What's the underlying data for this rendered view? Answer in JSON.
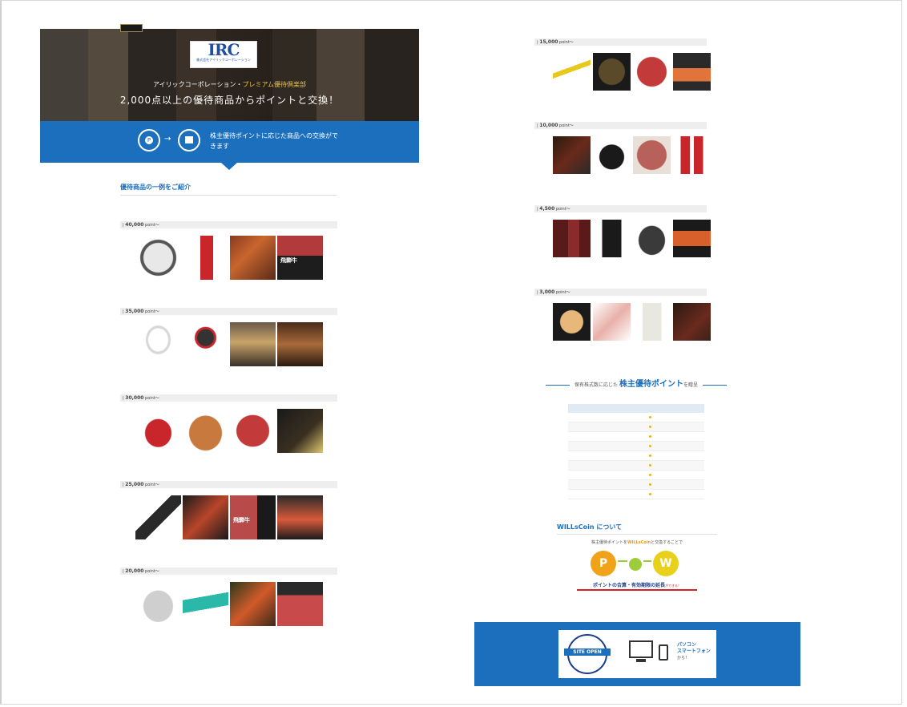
{
  "header": {
    "top_note": "",
    "logo_text": "IRC",
    "logo_sub": "株式会社アイリックコーポレーション",
    "hero_line1_prefix": "アイリックコーポレーション・",
    "hero_line1_gold": "プレミアム優待倶楽部",
    "hero_line2": "2,000点以上の優待商品からポイントと交換！",
    "band_text": "株主優待ポイントに応じた商品への交換ができます"
  },
  "intro": {
    "title": "優待商品の一例をご紹介",
    "note": ""
  },
  "left_tiers": [
    {
      "points": "40,000",
      "unit": "point〜",
      "range": "",
      "items": [
        {
          "kind": "robot",
          "caption": ""
        },
        {
          "kind": "red",
          "caption": ""
        },
        {
          "kind": "crab",
          "caption": ""
        },
        {
          "kind": "beef-promo",
          "caption": "",
          "overlay": "飛騨牛"
        }
      ]
    },
    {
      "points": "35,000",
      "unit": "point〜",
      "range": "",
      "items": [
        {
          "kind": "necklace",
          "caption": ""
        },
        {
          "kind": "golf",
          "caption": ""
        },
        {
          "kind": "sunset",
          "caption": ""
        },
        {
          "kind": "hotel",
          "caption": ""
        }
      ]
    },
    {
      "points": "30,000",
      "unit": "point〜",
      "range": "",
      "items": [
        {
          "kind": "pot",
          "caption": ""
        },
        {
          "kind": "crab2",
          "caption": ""
        },
        {
          "kind": "beef",
          "caption": ""
        },
        {
          "kind": "dessert",
          "caption": ""
        }
      ]
    },
    {
      "points": "25,000",
      "unit": "point〜",
      "range": "",
      "items": [
        {
          "kind": "knives",
          "caption": ""
        },
        {
          "kind": "lobster",
          "caption": ""
        },
        {
          "kind": "beef-promo2",
          "caption": "",
          "overlay": "飛騨牛"
        },
        {
          "kind": "fish",
          "caption": ""
        }
      ]
    },
    {
      "points": "20,000",
      "unit": "point〜",
      "range": "",
      "items": [
        {
          "kind": "steel",
          "caption": ""
        },
        {
          "kind": "teal",
          "caption": ""
        },
        {
          "kind": "crab3",
          "caption": ""
        },
        {
          "kind": "beef2",
          "caption": ""
        }
      ]
    }
  ],
  "right_tiers": [
    {
      "points": "15,000",
      "unit": "point〜",
      "range": "",
      "items": [
        {
          "kind": "tools",
          "caption": ""
        },
        {
          "kind": "abalone",
          "caption": ""
        },
        {
          "kind": "beef3",
          "caption": ""
        },
        {
          "kind": "sashimi",
          "caption": ""
        }
      ]
    },
    {
      "points": "10,000",
      "unit": "point〜",
      "range": "",
      "items": [
        {
          "kind": "steak",
          "caption": ""
        },
        {
          "kind": "kettle",
          "caption": ""
        },
        {
          "kind": "roast",
          "caption": ""
        },
        {
          "kind": "packs",
          "caption": ""
        }
      ]
    },
    {
      "points": "4,500",
      "unit": "point〜",
      "range": "",
      "items": [
        {
          "kind": "wine",
          "caption": ""
        },
        {
          "kind": "sake",
          "caption": ""
        },
        {
          "kind": "pan",
          "caption": ""
        },
        {
          "kind": "roe",
          "caption": ""
        }
      ]
    },
    {
      "points": "3,000",
      "unit": "point〜",
      "range": "",
      "items": [
        {
          "kind": "scallop",
          "caption": ""
        },
        {
          "kind": "ham",
          "caption": ""
        },
        {
          "kind": "rice",
          "caption": ""
        },
        {
          "kind": "jerky",
          "caption": ""
        }
      ]
    }
  ],
  "points_table": {
    "heading_prefix": "保有株式数に応じた",
    "heading_main": "株主優待ポイント",
    "heading_suffix": "を贈呈",
    "caption": "",
    "col1": "",
    "col2": "",
    "rows": [
      {
        "shares": "",
        "points": ""
      },
      {
        "shares": "",
        "points": ""
      },
      {
        "shares": "",
        "points": ""
      },
      {
        "shares": "",
        "points": ""
      },
      {
        "shares": "",
        "points": ""
      },
      {
        "shares": "",
        "points": ""
      },
      {
        "shares": "",
        "points": ""
      },
      {
        "shares": "",
        "points": ""
      },
      {
        "shares": "",
        "points": ""
      }
    ],
    "notes": ""
  },
  "willscoin": {
    "title": "WILLsCoin について",
    "lead_prefix": "株主優待ポイントを",
    "lead_em": "WILLsCoin",
    "lead_suffix": "と交換することで",
    "coin_p": "P",
    "coin_w": "W",
    "strap": "ポイントの合算・有効期限の延長",
    "strap_small": "ができる！",
    "body": ""
  },
  "footer": {
    "badge_top": "",
    "badge_ribbon": "SITE OPEN",
    "badge_bottom": "",
    "text_line1": "",
    "text_em1": "パソコン",
    "text_em2": "スマートフォン",
    "text_line4": "から！",
    "copyright": ""
  },
  "colors": {
    "brand_blue": "#1b6fbd",
    "gold": "#e8c34a",
    "coin_orange": "#f0a319",
    "coin_yellow": "#e9d11b"
  }
}
